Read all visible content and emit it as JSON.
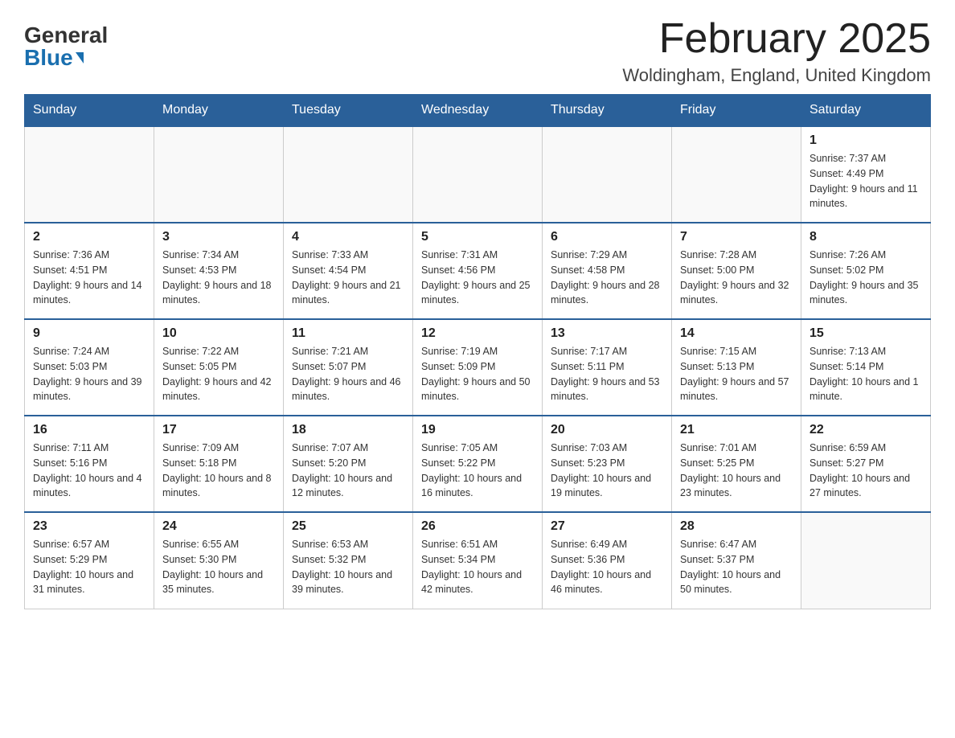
{
  "logo": {
    "general": "General",
    "blue": "Blue"
  },
  "title": "February 2025",
  "location": "Woldingham, England, United Kingdom",
  "days_of_week": [
    "Sunday",
    "Monday",
    "Tuesday",
    "Wednesday",
    "Thursday",
    "Friday",
    "Saturday"
  ],
  "weeks": [
    [
      {
        "day": "",
        "info": ""
      },
      {
        "day": "",
        "info": ""
      },
      {
        "day": "",
        "info": ""
      },
      {
        "day": "",
        "info": ""
      },
      {
        "day": "",
        "info": ""
      },
      {
        "day": "",
        "info": ""
      },
      {
        "day": "1",
        "info": "Sunrise: 7:37 AM\nSunset: 4:49 PM\nDaylight: 9 hours and 11 minutes."
      }
    ],
    [
      {
        "day": "2",
        "info": "Sunrise: 7:36 AM\nSunset: 4:51 PM\nDaylight: 9 hours and 14 minutes."
      },
      {
        "day": "3",
        "info": "Sunrise: 7:34 AM\nSunset: 4:53 PM\nDaylight: 9 hours and 18 minutes."
      },
      {
        "day": "4",
        "info": "Sunrise: 7:33 AM\nSunset: 4:54 PM\nDaylight: 9 hours and 21 minutes."
      },
      {
        "day": "5",
        "info": "Sunrise: 7:31 AM\nSunset: 4:56 PM\nDaylight: 9 hours and 25 minutes."
      },
      {
        "day": "6",
        "info": "Sunrise: 7:29 AM\nSunset: 4:58 PM\nDaylight: 9 hours and 28 minutes."
      },
      {
        "day": "7",
        "info": "Sunrise: 7:28 AM\nSunset: 5:00 PM\nDaylight: 9 hours and 32 minutes."
      },
      {
        "day": "8",
        "info": "Sunrise: 7:26 AM\nSunset: 5:02 PM\nDaylight: 9 hours and 35 minutes."
      }
    ],
    [
      {
        "day": "9",
        "info": "Sunrise: 7:24 AM\nSunset: 5:03 PM\nDaylight: 9 hours and 39 minutes."
      },
      {
        "day": "10",
        "info": "Sunrise: 7:22 AM\nSunset: 5:05 PM\nDaylight: 9 hours and 42 minutes."
      },
      {
        "day": "11",
        "info": "Sunrise: 7:21 AM\nSunset: 5:07 PM\nDaylight: 9 hours and 46 minutes."
      },
      {
        "day": "12",
        "info": "Sunrise: 7:19 AM\nSunset: 5:09 PM\nDaylight: 9 hours and 50 minutes."
      },
      {
        "day": "13",
        "info": "Sunrise: 7:17 AM\nSunset: 5:11 PM\nDaylight: 9 hours and 53 minutes."
      },
      {
        "day": "14",
        "info": "Sunrise: 7:15 AM\nSunset: 5:13 PM\nDaylight: 9 hours and 57 minutes."
      },
      {
        "day": "15",
        "info": "Sunrise: 7:13 AM\nSunset: 5:14 PM\nDaylight: 10 hours and 1 minute."
      }
    ],
    [
      {
        "day": "16",
        "info": "Sunrise: 7:11 AM\nSunset: 5:16 PM\nDaylight: 10 hours and 4 minutes."
      },
      {
        "day": "17",
        "info": "Sunrise: 7:09 AM\nSunset: 5:18 PM\nDaylight: 10 hours and 8 minutes."
      },
      {
        "day": "18",
        "info": "Sunrise: 7:07 AM\nSunset: 5:20 PM\nDaylight: 10 hours and 12 minutes."
      },
      {
        "day": "19",
        "info": "Sunrise: 7:05 AM\nSunset: 5:22 PM\nDaylight: 10 hours and 16 minutes."
      },
      {
        "day": "20",
        "info": "Sunrise: 7:03 AM\nSunset: 5:23 PM\nDaylight: 10 hours and 19 minutes."
      },
      {
        "day": "21",
        "info": "Sunrise: 7:01 AM\nSunset: 5:25 PM\nDaylight: 10 hours and 23 minutes."
      },
      {
        "day": "22",
        "info": "Sunrise: 6:59 AM\nSunset: 5:27 PM\nDaylight: 10 hours and 27 minutes."
      }
    ],
    [
      {
        "day": "23",
        "info": "Sunrise: 6:57 AM\nSunset: 5:29 PM\nDaylight: 10 hours and 31 minutes."
      },
      {
        "day": "24",
        "info": "Sunrise: 6:55 AM\nSunset: 5:30 PM\nDaylight: 10 hours and 35 minutes."
      },
      {
        "day": "25",
        "info": "Sunrise: 6:53 AM\nSunset: 5:32 PM\nDaylight: 10 hours and 39 minutes."
      },
      {
        "day": "26",
        "info": "Sunrise: 6:51 AM\nSunset: 5:34 PM\nDaylight: 10 hours and 42 minutes."
      },
      {
        "day": "27",
        "info": "Sunrise: 6:49 AM\nSunset: 5:36 PM\nDaylight: 10 hours and 46 minutes."
      },
      {
        "day": "28",
        "info": "Sunrise: 6:47 AM\nSunset: 5:37 PM\nDaylight: 10 hours and 50 minutes."
      },
      {
        "day": "",
        "info": ""
      }
    ]
  ]
}
